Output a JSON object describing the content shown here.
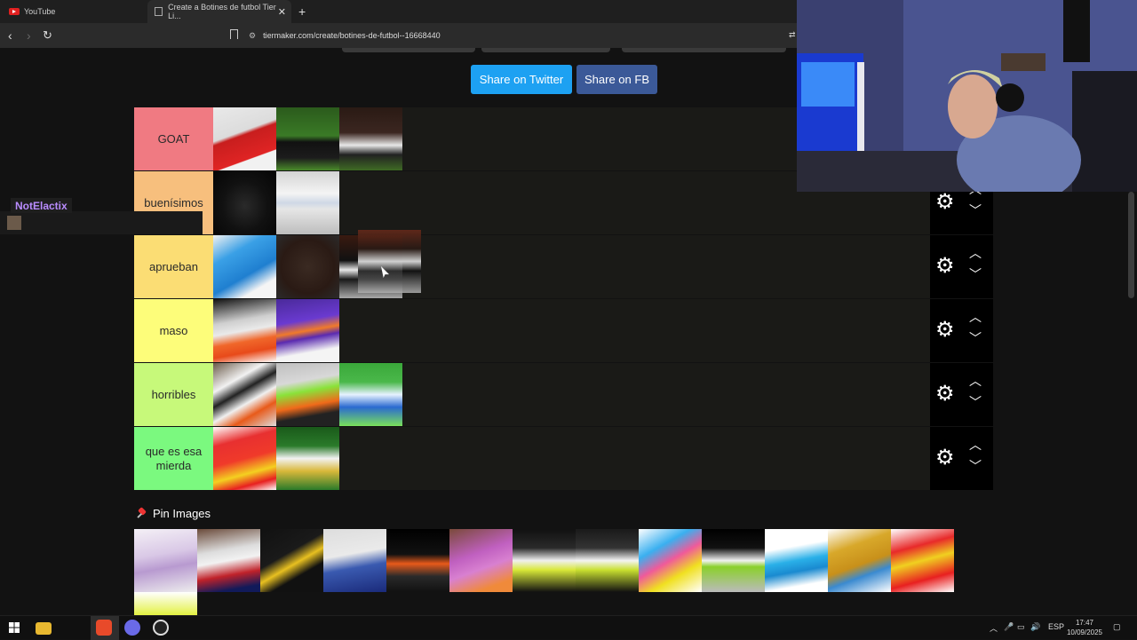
{
  "browser": {
    "tabs": [
      {
        "label": "YouTube"
      },
      {
        "label": "Create a Botines de futbol Tier Li..."
      }
    ],
    "url": "tiermaker.com/create/botines-de-futbol--16668440"
  },
  "share": {
    "twitter_label": "Share on Twitter",
    "fb_label": "Share on FB"
  },
  "tiers": [
    {
      "label": "GOAT",
      "color": "#f07a82"
    },
    {
      "label": "buenísimos",
      "color": "#f7bf7d"
    },
    {
      "label": "aprueban",
      "color": "#fbdd74"
    },
    {
      "label": "maso",
      "color": "#fdfd7a"
    },
    {
      "label": "horribles",
      "color": "#c7f97a"
    },
    {
      "label": "que es esa mierda",
      "color": "#7bf97f"
    }
  ],
  "pool": {
    "title": "Pin Images"
  },
  "chat": {
    "username": "NotElactix"
  },
  "taskbar": {
    "lang": "ESP",
    "time": "17:47",
    "date": "10/09/2025"
  }
}
